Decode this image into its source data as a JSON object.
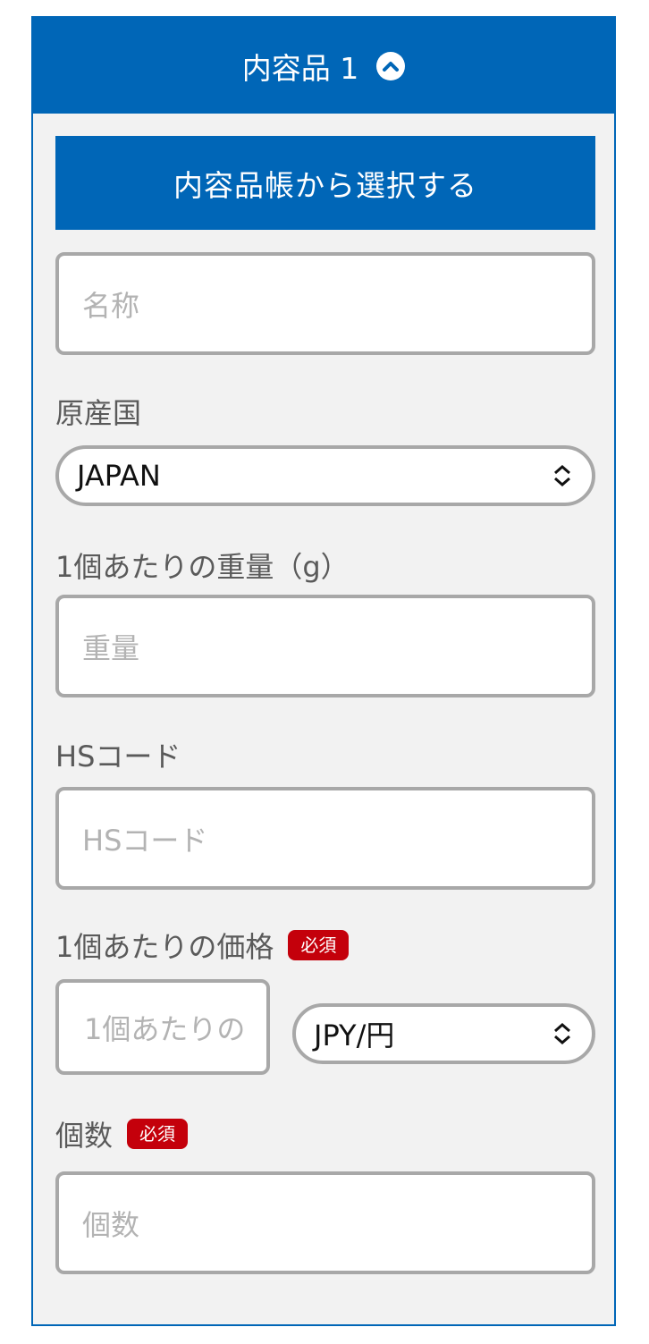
{
  "header": {
    "title": "内容品 1"
  },
  "select_from_book_label": "内容品帳から選択する",
  "name_field": {
    "placeholder": "名称"
  },
  "origin": {
    "label": "原産国",
    "value": "JAPAN"
  },
  "weight": {
    "label": "1個あたりの重量（g）",
    "placeholder": "重量"
  },
  "hs_code": {
    "label": "HSコード",
    "placeholder": "HSコード"
  },
  "price": {
    "label": "1個あたりの価格",
    "required": "必須",
    "placeholder": "1個あたりの",
    "currency": "JPY/円"
  },
  "quantity": {
    "label": "個数",
    "required": "必須",
    "placeholder": "個数"
  },
  "colors": {
    "brand": "#0066b7",
    "required": "#c4000b"
  }
}
